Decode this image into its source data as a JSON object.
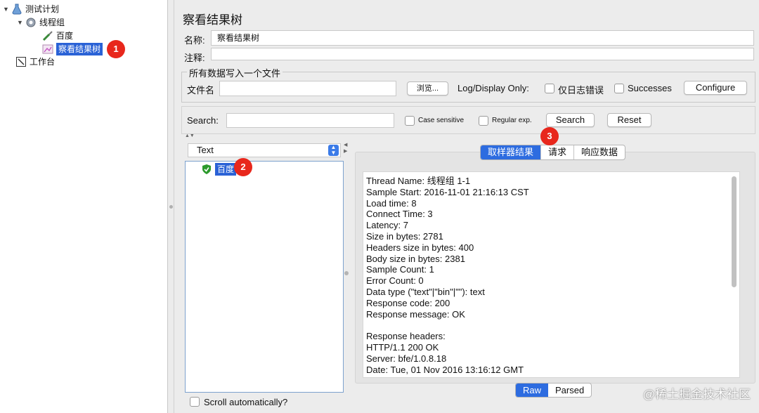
{
  "tree": {
    "items": [
      {
        "label": "测试计划"
      },
      {
        "label": "线程组"
      },
      {
        "label": "百度"
      },
      {
        "label": "察看结果树"
      },
      {
        "label": "工作台"
      }
    ]
  },
  "annotations": [
    "1",
    "2",
    "3"
  ],
  "panel": {
    "title": "察看结果树",
    "name_label": "名称:",
    "name_value": "察看结果树",
    "comment_label": "注释:",
    "comment_value": "",
    "file_group_title": "所有数据写入一个文件",
    "filename_label": "文件名",
    "filename_value": "",
    "browse_label": "浏览...",
    "log_display_label": "Log/Display Only:",
    "errors_only_label": "仅日志错误",
    "successes_label": "Successes",
    "configure_label": "Configure"
  },
  "search": {
    "label": "Search:",
    "value": "",
    "case_sensitive_label": "Case sensitive",
    "regex_label": "Regular exp.",
    "search_button": "Search",
    "reset_button": "Reset"
  },
  "renderer": {
    "selected": "Text"
  },
  "sample_tree": {
    "items": [
      {
        "label": "百度",
        "status": "success"
      }
    ]
  },
  "result_tabs": [
    {
      "label": "取样器结果",
      "active": true
    },
    {
      "label": "请求",
      "active": false
    },
    {
      "label": "响应数据",
      "active": false
    }
  ],
  "result_lines": [
    "Thread Name: 线程组 1-1",
    "Sample Start: 2016-11-01 21:16:13 CST",
    "Load time: 8",
    "Connect Time: 3",
    "Latency: 7",
    "Size in bytes: 2781",
    "Headers size in bytes: 400",
    "Body size in bytes: 2381",
    "Sample Count: 1",
    "Error Count: 0",
    "Data type (\"text\"|\"bin\"|\"\"): text",
    "Response code: 200",
    "Response message: OK",
    "",
    "Response headers:",
    "HTTP/1.1 200 OK",
    "Server: bfe/1.0.8.18",
    "Date: Tue, 01 Nov 2016 13:16:12 GMT"
  ],
  "view_modes": [
    {
      "label": "Raw",
      "active": true
    },
    {
      "label": "Parsed",
      "active": false
    }
  ],
  "scroll_auto_label": "Scroll automatically?",
  "watermark": "@稀土掘金技术社区",
  "colors": {
    "selection": "#2a62d6",
    "badge": "#e8271c",
    "active_tab": "#2d6ce0"
  }
}
